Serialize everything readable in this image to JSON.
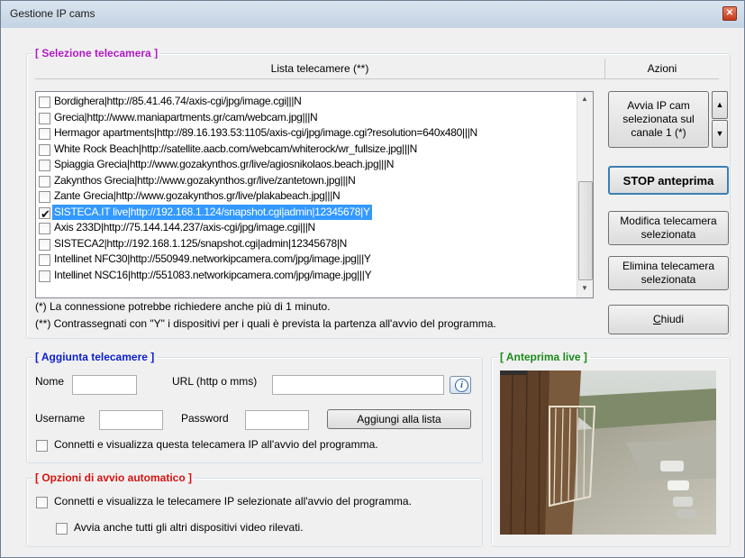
{
  "window": {
    "title": "Gestione IP cams"
  },
  "selezione": {
    "legend": "[ Selezione telecamera ]",
    "list_header": "Lista telecamere (**)",
    "actions_header": "Azioni",
    "cameras": [
      {
        "label": "Bordighera|http://85.41.46.74/axis-cgi/jpg/image.cgi|||N",
        "checked": false
      },
      {
        "label": "Grecia|http://www.maniapartments.gr/cam/webcam.jpg|||N",
        "checked": false
      },
      {
        "label": "Hermagor apartments|http://89.16.193.53:1105/axis-cgi/jpg/image.cgi?resolution=640x480|||N",
        "checked": false
      },
      {
        "label": "White Rock Beach|http://satellite.aacb.com/webcam/whiterock/wr_fullsize.jpg|||N",
        "checked": false
      },
      {
        "label": "Spiaggia Grecia|http://www.gozakynthos.gr/live/agiosnikolaos.beach.jpg|||N",
        "checked": false
      },
      {
        "label": "Zakynthos Grecia|http://www.gozakynthos.gr/live/zantetown.jpg|||N",
        "checked": false
      },
      {
        "label": "Zante Grecia|http://www.gozakynthos.gr/live/plakabeach.jpg|||N",
        "checked": false
      },
      {
        "label": "SISTECA.IT live|http://192.168.1.124/snapshot.cgi|admin|12345678|Y",
        "checked": true,
        "selected": true
      },
      {
        "label": "Axis 233D|http://75.144.144.237/axis-cgi/jpg/image.cgi|||N",
        "checked": false
      },
      {
        "label": "SISTECA2|http://192.168.1.125/snapshot.cgi|admin|12345678|N",
        "checked": false
      },
      {
        "label": "Intellinet NFC30|http://550949.networkipcamera.com/jpg/image.jpg|||Y",
        "checked": false
      },
      {
        "label": "Intellinet NSC16|http://551083.networkipcamera.com/jpg/image.jpg|||Y",
        "checked": false
      }
    ],
    "note1": "(*) La connessione potrebbe richiedere anche più di 1 minuto.",
    "note2": "(**) Contrassegnati con \"Y\" i dispositivi per i quali è prevista la partenza all'avvio del programma.",
    "buttons": {
      "avvia": "Avvia IP cam selezionata sul canale 1 (*)",
      "stop": "STOP anteprima",
      "modifica": "Modifica telecamera selezionata",
      "elimina": "Elimina telecamera selezionata",
      "chiudi_prefix": "C",
      "chiudi_rest": "hiudi"
    }
  },
  "aggiunta": {
    "legend": "[ Aggiunta telecamere ]",
    "nome_label": "Nome",
    "nome_value": "",
    "url_label": "URL (http o mms)",
    "url_value": "",
    "username_label": "Username",
    "username_value": "",
    "password_label": "Password",
    "password_value": "",
    "add_button": "Aggiungi alla lista",
    "autoconnect_label": "Connetti e visualizza questa telecamera IP all'avvio del programma.",
    "autoconnect_checked": false
  },
  "opzioni": {
    "legend": "[ Opzioni di avvio automatico ]",
    "opt1": "Connetti e visualizza le telecamere IP selezionate all'avvio del programma.",
    "opt1_checked": false,
    "opt2": "Avvia anche tutti gli altri dispositivi video rilevati.",
    "opt2_checked": false
  },
  "anteprima": {
    "legend": "[ Anteprima live ]"
  },
  "colors": {
    "selection": "#3399ff",
    "legend_purple": "#b018c7",
    "legend_blue": "#0b1dcc",
    "legend_red": "#d6120f",
    "legend_green": "#1a8a1a"
  },
  "icons": [
    "close-icon",
    "info-icon",
    "scroll-up-arrow-icon",
    "scroll-down-arrow-icon",
    "spin-up-icon",
    "spin-down-icon"
  ]
}
